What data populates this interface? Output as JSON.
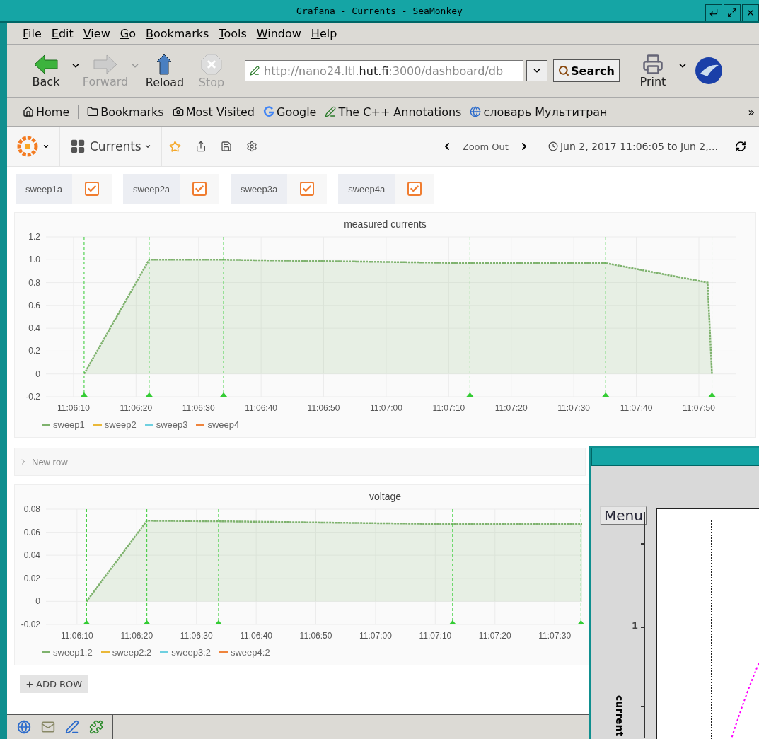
{
  "window": {
    "title": "Grafana - Currents - SeaMonkey"
  },
  "menu_bar": [
    "File",
    "Edit",
    "View",
    "Go",
    "Bookmarks",
    "Tools",
    "Window",
    "Help"
  ],
  "navigation": {
    "buttons": [
      {
        "label": "Back",
        "disabled": false
      },
      {
        "label": "Forward",
        "disabled": true
      },
      {
        "label": "Reload",
        "disabled": false
      },
      {
        "label": "Stop",
        "disabled": true
      }
    ],
    "url": "http://nano24.ltl.**hut.fi**:3000/dashboard/db",
    "search": "Search",
    "print": "Print"
  },
  "bookmarks": {
    "items": [
      {
        "label": "Home",
        "kind": "home"
      },
      {
        "label": "Bookmarks",
        "kind": "folder"
      },
      {
        "label": "Most Visited",
        "kind": "history"
      },
      {
        "label": "Google",
        "kind": "g"
      },
      {
        "label": "The C++ Annotations",
        "kind": "pen"
      },
      {
        "label": "словарь Мультитран",
        "kind": "globe"
      }
    ],
    "overflow": "»"
  },
  "dashboard": {
    "title": "Currents",
    "zoom_out": "Zoom Out",
    "time_range": "Jun 2, 2017 11:06:05 to Jun 2,...",
    "variables": [
      {
        "label": "sweep1a",
        "checked": true
      },
      {
        "label": "sweep2a",
        "checked": true
      },
      {
        "label": "sweep3a",
        "checked": true
      },
      {
        "label": "sweep4a",
        "checked": true
      }
    ],
    "panels": [
      {
        "chart_data": {
          "type": "area",
          "grid": true,
          "title": "measured currents",
          "x": [
            39971.7,
            39982.1,
            39994.0,
            40033.4,
            40055.1,
            40071.4,
            40072.1
          ],
          "series": [
            {
              "name": "sweep1",
              "color": "#7eb26d",
              "line_style": "dotted",
              "values": [
                0,
                1.0,
                1.0,
                0.97,
                0.97,
                0.8,
                0
              ]
            },
            {
              "name": "sweep2",
              "color": "#eab839",
              "values": [
                null,
                null,
                null,
                null,
                null,
                null,
                null
              ]
            },
            {
              "name": "sweep3",
              "color": "#6ed0e0",
              "values": [
                null,
                null,
                null,
                null,
                null,
                null,
                null
              ]
            },
            {
              "name": "sweep4",
              "color": "#ef843c",
              "values": [
                null,
                null,
                null,
                null,
                null,
                null,
                null
              ]
            }
          ],
          "xlim": [
            39965.6,
            40076
          ],
          "ylim": [
            -0.2,
            1.2
          ],
          "xticks": [
            {
              "value": 39970,
              "label": "11:06:10"
            },
            {
              "value": 39980,
              "label": "11:06:20"
            },
            {
              "value": 39990,
              "label": "11:06:30"
            },
            {
              "value": 40000,
              "label": "11:06:40"
            },
            {
              "value": 40010,
              "label": "11:06:50"
            },
            {
              "value": 40020,
              "label": "11:07:00"
            },
            {
              "value": 40030,
              "label": "11:07:10"
            },
            {
              "value": 40040,
              "label": "11:07:20"
            },
            {
              "value": 40050,
              "label": "11:07:30"
            },
            {
              "value": 40060,
              "label": "11:07:40"
            },
            {
              "value": 40070,
              "label": "11:07:50"
            }
          ],
          "yticks": [
            {
              "value": 1.2,
              "label": "1.2"
            },
            {
              "value": 1.0,
              "label": "1.0"
            },
            {
              "value": 0.8,
              "label": "0.8"
            },
            {
              "value": 0.6,
              "label": "0.6"
            },
            {
              "value": 0.4,
              "label": "0.4"
            },
            {
              "value": 0.2,
              "label": "0.2"
            },
            {
              "value": 0,
              "label": "0"
            },
            {
              "value": -0.2,
              "label": "-0.2"
            }
          ],
          "ref_lines": [
            {
              "axis": "x",
              "value": 39971.7,
              "color": "#33cc33"
            },
            {
              "axis": "x",
              "value": 39982.1,
              "color": "#33cc33"
            },
            {
              "axis": "x",
              "value": 39994.0,
              "color": "#33cc33"
            },
            {
              "axis": "x",
              "value": 40033.4,
              "color": "#33cc33"
            },
            {
              "axis": "x",
              "value": 40055.1,
              "color": "#33cc33"
            },
            {
              "axis": "x",
              "value": 40072.1,
              "color": "#33cc33"
            }
          ]
        }
      },
      {
        "chart_data": {
          "type": "area",
          "grid": true,
          "title": "voltage",
          "x": [
            39971.6,
            39981.7,
            39993.7,
            40032.9,
            40054.6
          ],
          "series": [
            {
              "name": "sweep1:2",
              "color": "#7eb26d",
              "line_style": "dotted",
              "values": [
                0,
                0.07,
                0.0695,
                0.067,
                0.067
              ]
            },
            {
              "name": "sweep2:2",
              "color": "#eab839",
              "values": [
                null,
                null,
                null,
                null,
                null
              ]
            },
            {
              "name": "sweep3:2",
              "color": "#6ed0e0",
              "values": [
                null,
                null,
                null,
                null,
                null
              ]
            },
            {
              "name": "sweep4:2",
              "color": "#ef843c",
              "values": [
                null,
                null,
                null,
                null,
                null
              ]
            }
          ],
          "xlim": [
            39964.8,
            40054.6
          ],
          "ylim": [
            -0.02,
            0.08
          ],
          "xticks": [
            {
              "value": 39970,
              "label": "11:06:10"
            },
            {
              "value": 39980,
              "label": "11:06:20"
            },
            {
              "value": 39990,
              "label": "11:06:30"
            },
            {
              "value": 40000,
              "label": "11:06:40"
            },
            {
              "value": 40010,
              "label": "11:06:50"
            },
            {
              "value": 40020,
              "label": "11:07:00"
            },
            {
              "value": 40030,
              "label": "11:07:10"
            },
            {
              "value": 40040,
              "label": "11:07:20"
            },
            {
              "value": 40050,
              "label": "11:07:30"
            }
          ],
          "yticks": [
            {
              "value": 0.08,
              "label": "0.08"
            },
            {
              "value": 0.06,
              "label": "0.06"
            },
            {
              "value": 0.04,
              "label": "0.04"
            },
            {
              "value": 0.02,
              "label": "0.02"
            },
            {
              "value": 0,
              "label": "0"
            },
            {
              "value": -0.02,
              "label": "-0.02"
            }
          ],
          "ref_lines": [
            {
              "axis": "x",
              "value": 39971.6,
              "color": "#33cc33"
            },
            {
              "axis": "x",
              "value": 39981.7,
              "color": "#33cc33"
            },
            {
              "axis": "x",
              "value": 39993.7,
              "color": "#33cc33"
            },
            {
              "axis": "x",
              "value": 40032.9,
              "color": "#33cc33"
            },
            {
              "axis": "x",
              "value": 40054.4,
              "color": "#33cc33"
            }
          ]
        }
      }
    ],
    "new_row": "New row",
    "add_row": "ADD ROW"
  },
  "second_window": {
    "menu_button": "Menu",
    "y_tick": "1",
    "y_label": "current"
  }
}
